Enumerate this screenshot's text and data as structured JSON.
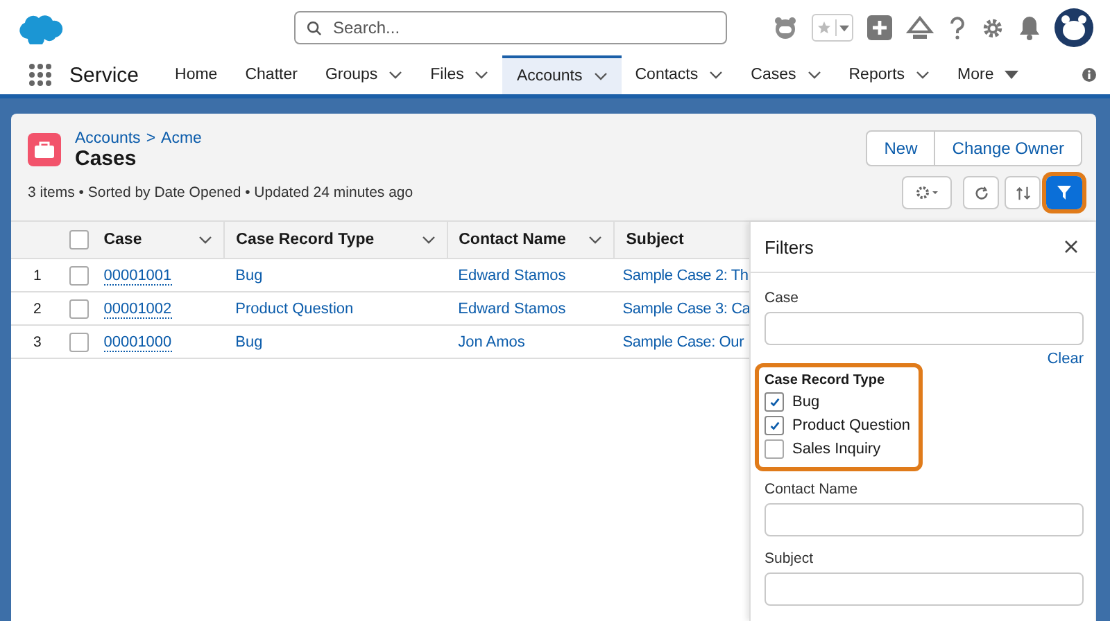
{
  "header": {
    "search_placeholder": "Search..."
  },
  "nav": {
    "app_name": "Service",
    "items": [
      {
        "label": "Home",
        "dropdown": false,
        "selected": false
      },
      {
        "label": "Chatter",
        "dropdown": false,
        "selected": false
      },
      {
        "label": "Groups",
        "dropdown": true,
        "selected": false
      },
      {
        "label": "Files",
        "dropdown": true,
        "selected": false
      },
      {
        "label": "Accounts",
        "dropdown": true,
        "selected": true
      },
      {
        "label": "Contacts",
        "dropdown": true,
        "selected": false
      },
      {
        "label": "Cases",
        "dropdown": true,
        "selected": false
      },
      {
        "label": "Reports",
        "dropdown": true,
        "selected": false
      }
    ],
    "more": "More"
  },
  "list_view": {
    "breadcrumb": [
      {
        "label": "Accounts"
      },
      {
        "label": "Acme"
      }
    ],
    "separator": ">",
    "title": "Cases",
    "info": "3 items • Sorted by Date Opened • Updated 24 minutes ago",
    "buttons": [
      "New",
      "Change Owner"
    ],
    "filter_button": {
      "selected": true,
      "highlighted": true
    }
  },
  "table": {
    "all_checked": false,
    "columns": [
      "Case",
      "Case Record Type",
      "Contact Name",
      "Subject"
    ],
    "rows": [
      {
        "number": "1",
        "checked": false,
        "cells": [
          "00001001",
          "Bug",
          "Edward Stamos",
          "Sample Case 2: Th"
        ]
      },
      {
        "number": "2",
        "checked": false,
        "cells": [
          "00001002",
          "Product Question",
          "Edward Stamos",
          "Sample Case 3: Ca"
        ]
      },
      {
        "number": "3",
        "checked": false,
        "cells": [
          "00001000",
          "Bug",
          "Jon Amos",
          "Sample Case: Our"
        ]
      }
    ]
  },
  "filters": {
    "title": "Filters",
    "clear": "Clear",
    "fields": [
      {
        "kind": "text",
        "label": "Case"
      },
      {
        "kind": "checkboxes",
        "label": "Case Record Type",
        "highlighted": true,
        "options": [
          {
            "label": "Bug",
            "checked": true
          },
          {
            "label": "Product Question",
            "checked": true
          },
          {
            "label": "Sales Inquiry",
            "checked": false
          }
        ]
      },
      {
        "kind": "text",
        "label": "Contact Name"
      },
      {
        "kind": "text",
        "label": "Subject"
      }
    ]
  }
}
